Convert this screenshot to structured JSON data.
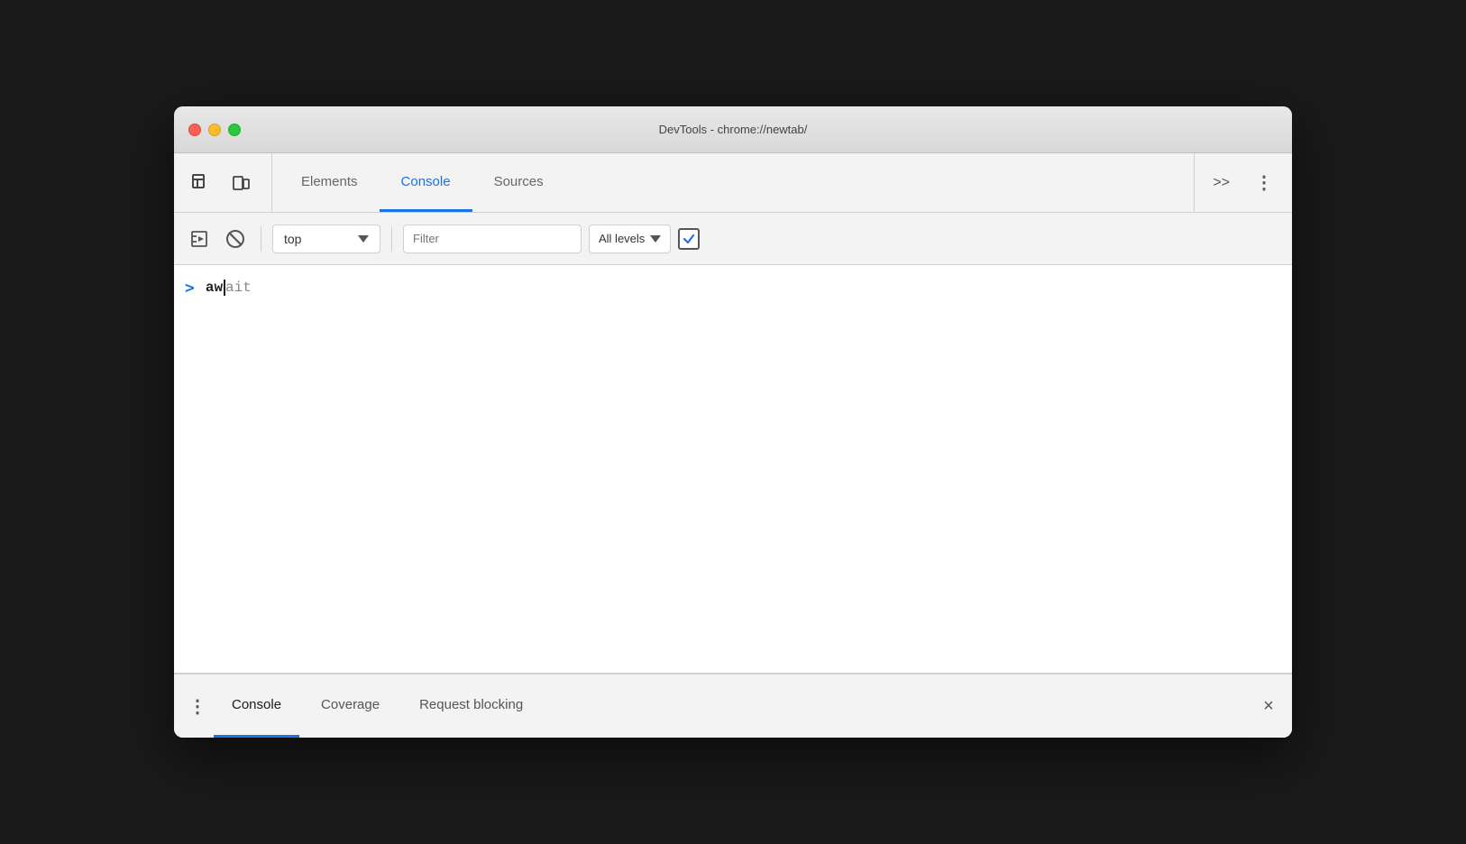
{
  "window": {
    "title": "DevTools - chrome://newtab/"
  },
  "traffic_lights": {
    "close": "close",
    "minimize": "minimize",
    "maximize": "maximize"
  },
  "tab_bar": {
    "tabs": [
      {
        "id": "elements",
        "label": "Elements",
        "active": false
      },
      {
        "id": "console",
        "label": "Console",
        "active": true
      },
      {
        "id": "sources",
        "label": "Sources",
        "active": false
      }
    ],
    "more_label": ">>",
    "menu_label": "⋮"
  },
  "console_toolbar": {
    "context_label": "top",
    "filter_placeholder": "Filter",
    "levels_label": "All levels"
  },
  "console": {
    "prompt_symbol": ">",
    "typed_text": "aw",
    "autocomplete_text": "ait"
  },
  "bottom_panel": {
    "menu_icon": "⋮",
    "tabs": [
      {
        "id": "console",
        "label": "Console",
        "active": true
      },
      {
        "id": "coverage",
        "label": "Coverage",
        "active": false
      },
      {
        "id": "request-blocking",
        "label": "Request blocking",
        "active": false
      }
    ],
    "close_label": "×"
  }
}
